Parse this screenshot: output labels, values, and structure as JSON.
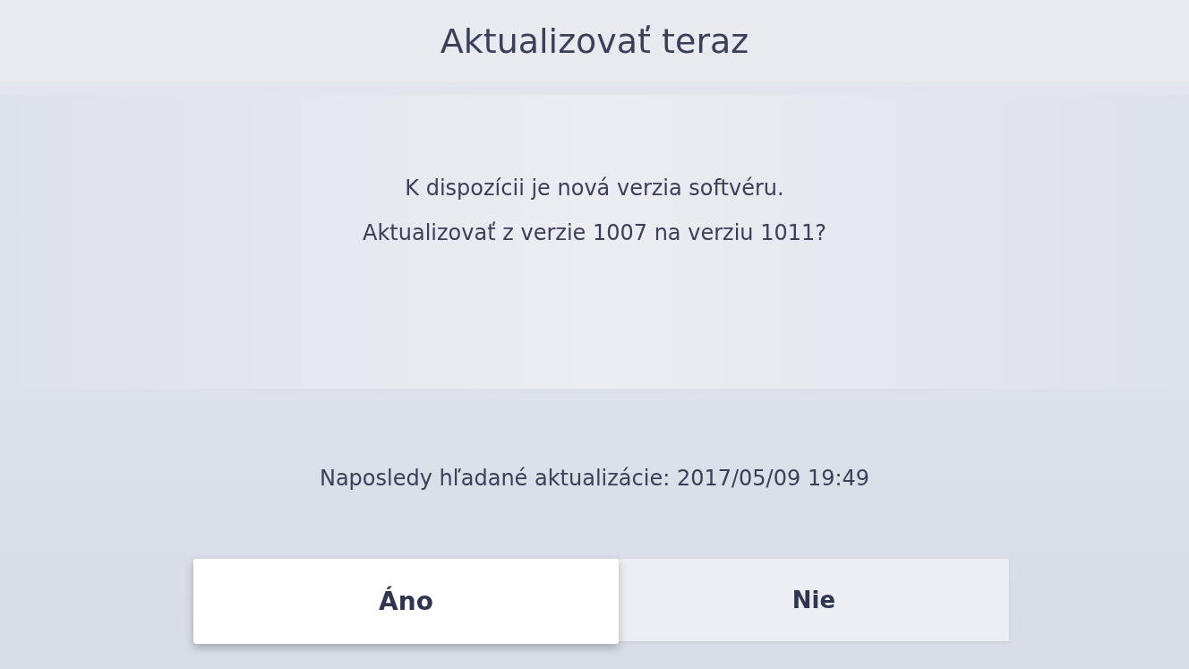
{
  "title": "Aktualizovať teraz",
  "message": [
    "K dispozícii je nová verzia softvéru.",
    "Aktualizovať z verzie 1007 na verziu 1011?"
  ],
  "last_check": "Naposledy hľadané aktualizácie: 2017/05/09 19:49",
  "buttons": [
    {
      "label": "Áno",
      "selected": true
    },
    {
      "label": "Nie",
      "selected": false
    }
  ]
}
